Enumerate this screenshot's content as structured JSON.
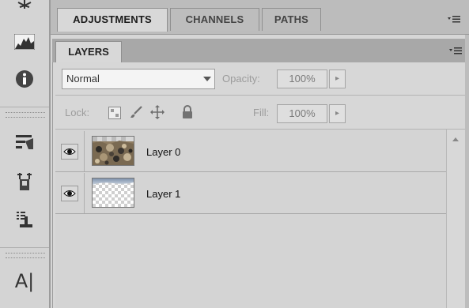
{
  "tabs": [
    {
      "label": "ADJUSTMENTS",
      "active": true
    },
    {
      "label": "CHANNELS",
      "active": false
    },
    {
      "label": "PATHS",
      "active": false
    }
  ],
  "layers_panel": {
    "tab_label": "LAYERS",
    "blend_mode": "Normal",
    "opacity_label": "Opacity:",
    "opacity_value": "100%",
    "lock_label": "Lock:",
    "fill_label": "Fill:",
    "fill_value": "100%",
    "layers": [
      {
        "name": "Layer 0",
        "visible": true,
        "thumbnail": "rocky-texture"
      },
      {
        "name": "Layer 1",
        "visible": true,
        "thumbnail": "sky-over-transparency"
      }
    ]
  },
  "dock": {
    "icons": [
      "puppet-warp-icon",
      "histogram-icon",
      "info-icon",
      "brush-presets-icon",
      "clone-source-icon",
      "tool-presets-icon",
      "character-icon"
    ],
    "character_glyph": "A|"
  },
  "colors": {
    "panel_bg": "#d6d6d6",
    "tab_bar_bg": "#bcbcbc",
    "active_tab_bg": "#d8d8d8"
  }
}
